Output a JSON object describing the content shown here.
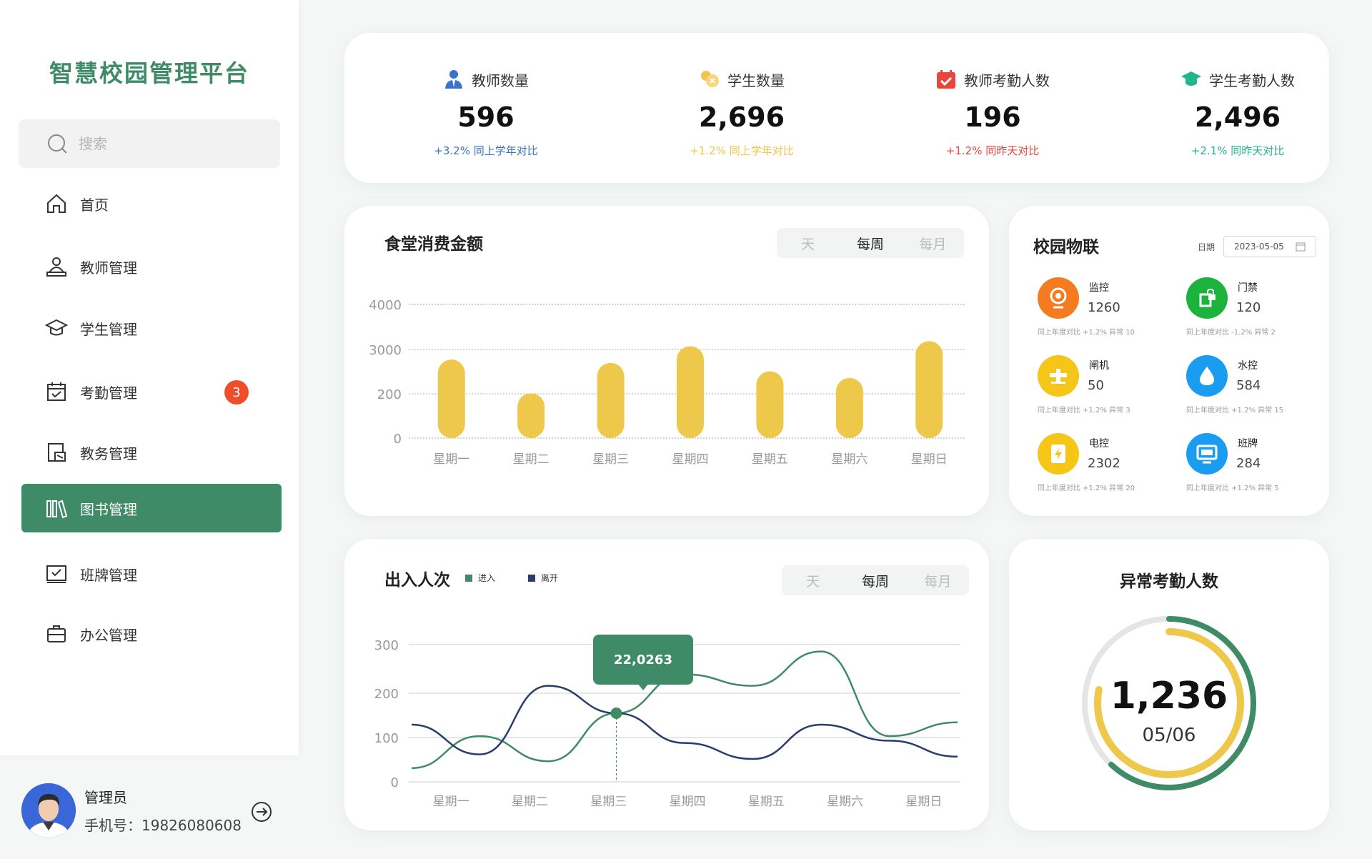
{
  "brand": "智慧校园管理平台",
  "search": {
    "placeholder": "搜索"
  },
  "nav": [
    {
      "label": "首页",
      "icon": "home-icon"
    },
    {
      "label": "教师管理",
      "icon": "teacher-icon"
    },
    {
      "label": "学生管理",
      "icon": "graduation-cap-icon"
    },
    {
      "label": "考勤管理",
      "icon": "calendar-check-icon",
      "badge": "3"
    },
    {
      "label": "教务管理",
      "icon": "document-icon"
    },
    {
      "label": "图书管理",
      "icon": "books-icon",
      "active": true
    },
    {
      "label": "班牌管理",
      "icon": "board-icon"
    },
    {
      "label": "办公管理",
      "icon": "briefcase-icon"
    }
  ],
  "profile": {
    "name": "管理员",
    "phone": "手机号：19826080608"
  },
  "stats": [
    {
      "label": "教师数量",
      "value": "596",
      "delta": "+3.2% 同上学年对比",
      "color": "#3a73c9"
    },
    {
      "label": "学生数量",
      "value": "2,696",
      "delta": "+1.2% 同上学年对比",
      "color": "#f0c64a"
    },
    {
      "label": "教师考勤人数",
      "value": "196",
      "delta": "+1.2% 同昨天对比",
      "color": "#e8463c"
    },
    {
      "label": "学生考勤人数",
      "value": "2,496",
      "delta": "+2.1% 同昨天对比",
      "color": "#21b58e"
    }
  ],
  "canteen": {
    "title": "食堂消费金额",
    "tabs": [
      "天",
      "每周",
      "每月"
    ]
  },
  "iot": {
    "title": "校园物联",
    "date_label": "日期",
    "date_value": "2023-05-05",
    "items": [
      {
        "name": "监控",
        "value": "1260",
        "sub": "同上年度对比 +1.2% 异常 10",
        "color": "#f47b20",
        "icon": "camera-icon"
      },
      {
        "name": "门禁",
        "value": "120",
        "sub": "同上年度对比 -1.2% 异常 2",
        "color": "#1bb33c",
        "icon": "door-lock-icon"
      },
      {
        "name": "闸机",
        "value": "50",
        "sub": "同上年度对比 +1.2% 异常 3",
        "color": "#f5c518",
        "icon": "gate-icon"
      },
      {
        "name": "水控",
        "value": "584",
        "sub": "同上年度对比 +1.2% 异常 15",
        "color": "#1a9df0",
        "icon": "water-drop-icon"
      },
      {
        "name": "电控",
        "value": "2302",
        "sub": "同上年度对比 +1.2% 异常 20",
        "color": "#f5c518",
        "icon": "power-icon"
      },
      {
        "name": "班牌",
        "value": "284",
        "sub": "同上年度对比 +1.2% 异常 5",
        "color": "#1a9df0",
        "icon": "monitor-icon"
      }
    ]
  },
  "traffic": {
    "title": "出入人次",
    "tabs": [
      "天",
      "每周",
      "每月"
    ],
    "tooltip": "22,0263"
  },
  "abnormal": {
    "title": "异常考勤人数",
    "value": "1,236",
    "date": "05/06"
  },
  "chart_data": [
    {
      "type": "bar",
      "categories": [
        "星期一",
        "星期二",
        "星期三",
        "星期四",
        "星期五",
        "星期六",
        "星期日"
      ],
      "yticks": [
        "0",
        "200",
        "3000",
        "4000"
      ],
      "values": [
        2350,
        1340,
        2250,
        2750,
        2000,
        1800,
        2900
      ],
      "ylim": [
        0,
        4000
      ],
      "color": "#edc84b"
    },
    {
      "type": "line",
      "categories": [
        "星期一",
        "星期二",
        "星期三",
        "星期四",
        "星期五",
        "星期六",
        "星期日"
      ],
      "yticks": [
        "0",
        "100",
        "200",
        "300"
      ],
      "ylim": [
        0,
        300
      ],
      "series": [
        {
          "name": "进入",
          "color": "#3f8a67",
          "values": [
            30,
            100,
            45,
            150,
            235,
            210,
            285,
            100,
            130
          ]
        },
        {
          "name": "离开",
          "color": "#283d6e",
          "values": [
            125,
            60,
            210,
            150,
            85,
            50,
            125,
            90,
            55
          ]
        }
      ]
    },
    {
      "type": "pie",
      "series": [
        {
          "color": "#3f8a67",
          "value": 0.62
        },
        {
          "color": "#edc84b",
          "value": 0.78
        }
      ]
    }
  ]
}
